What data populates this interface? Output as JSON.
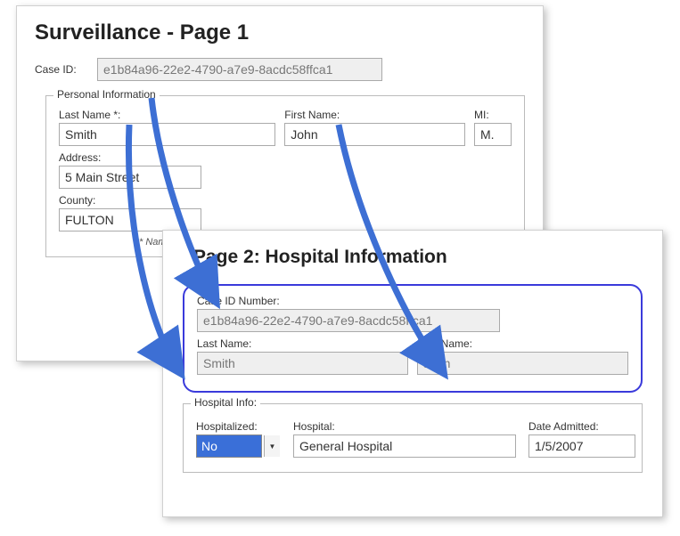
{
  "page1": {
    "title": "Surveillance - Page 1",
    "caseIdLabel": "Case ID:",
    "caseId": "e1b84a96-22e2-4790-a7e9-8acdc58ffca1",
    "personal": {
      "legend": "Personal Information",
      "lastNameLabel": "Last Name *:",
      "lastName": "Smith",
      "firstNameLabel": "First Name:",
      "firstName": "John",
      "miLabel": "MI:",
      "mi": "M.",
      "addressLabel": "Address:",
      "address": "5 Main Street",
      "countyLabel": "County:",
      "county": "FULTON",
      "note": "* Names, addre…"
    }
  },
  "page2": {
    "title": "Page 2: Hospital Information",
    "mirror": {
      "caseIdLabel": "Case ID Number:",
      "caseId": "e1b84a96-22e2-4790-a7e9-8acdc58ffca1",
      "lastNameLabel": "Last Name:",
      "lastName": "Smith",
      "firstNameLabel": "First Name:",
      "firstName": "John"
    },
    "hospital": {
      "legend": "Hospital Info:",
      "hospitalizedLabel": "Hospitalized:",
      "hospitalized": "No",
      "hospitalLabel": "Hospital:",
      "hospitalName": "General Hospital",
      "dateAdmittedLabel": "Date Admitted:",
      "dateAdmitted": "1/5/2007"
    }
  }
}
